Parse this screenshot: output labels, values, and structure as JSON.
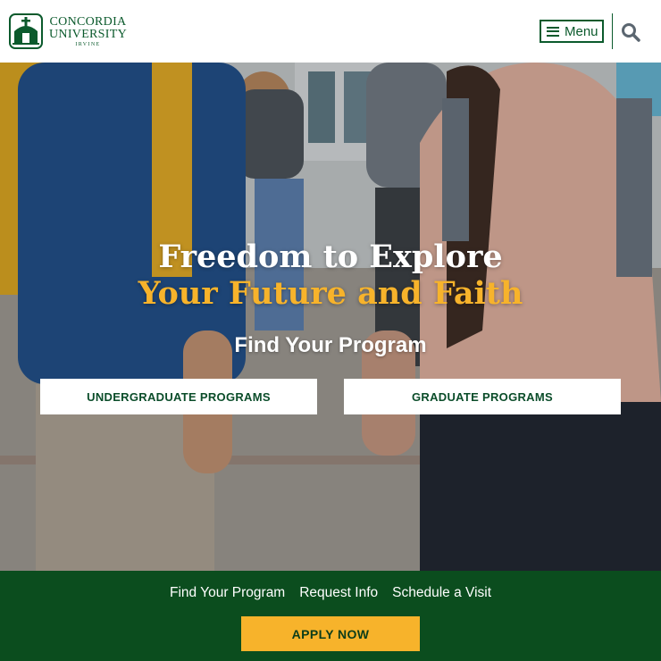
{
  "header": {
    "logo": {
      "line1": "CONCORDIA",
      "line2": "UNIVERSITY",
      "line3": "IRVINE"
    },
    "menu_label": "Menu",
    "search_icon": "search-icon"
  },
  "hero": {
    "title_line1": "Freedom to Explore",
    "title_line2": "Your Future and Faith",
    "subtitle": "Find Your Program",
    "buttons": {
      "undergraduate": "UNDERGRADUATE PROGRAMS",
      "graduate": "GRADUATE PROGRAMS"
    }
  },
  "bottom_bar": {
    "links": [
      "Find Your Program",
      "Request Info",
      "Schedule a Visit"
    ],
    "apply_label": "APPLY NOW"
  },
  "colors": {
    "brand_green": "#0b5a2c",
    "bar_green": "#0b4d1e",
    "gold": "#f7b32b",
    "white": "#ffffff"
  }
}
